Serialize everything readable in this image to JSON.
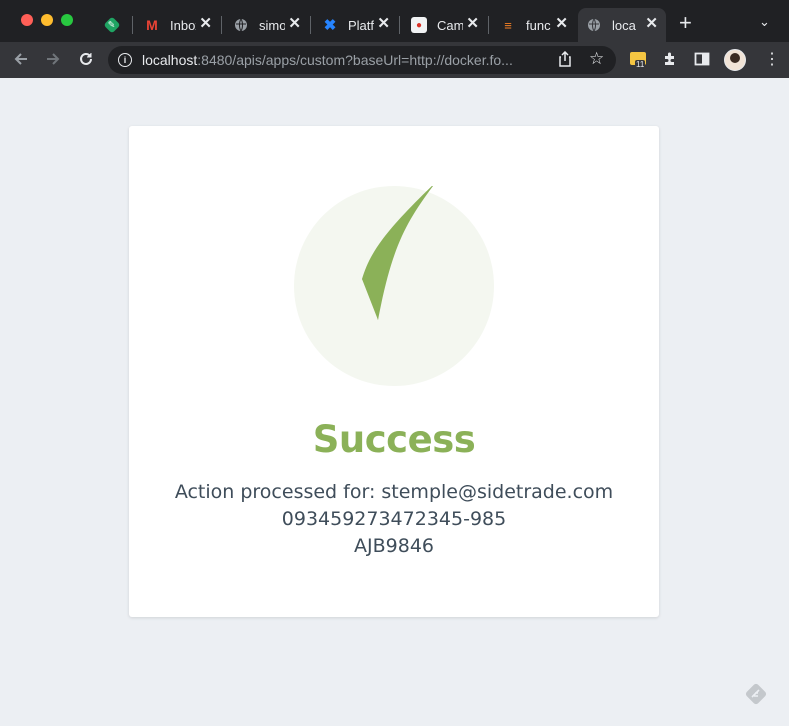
{
  "browser": {
    "tabs": [
      {
        "title": "",
        "favicon": "feather-green-icon"
      },
      {
        "title": "Inbox",
        "favicon": "gmail-icon"
      },
      {
        "title": "simo",
        "favicon": "globe-icon"
      },
      {
        "title": "Platf",
        "favicon": "confluence-icon"
      },
      {
        "title": "Cam",
        "favicon": "app-icon"
      },
      {
        "title": "func",
        "favicon": "stackoverflow-icon"
      },
      {
        "title": "loca",
        "favicon": "globe-icon"
      }
    ],
    "url_host": "localhost",
    "url_rest": ":8480/apis/apps/custom?baseUrl=http://docker.fo...",
    "extension_badge": "11"
  },
  "page": {
    "title": "Success",
    "message_line1": "Action processed for: stemple@sidetrade.com",
    "message_line2": "093459273472345-985",
    "message_line3": "AJB9846"
  },
  "colors": {
    "success_green": "#8bb158",
    "circle_bg": "#f4f7f0",
    "page_bg": "#eceff3",
    "text": "#3f4d5a"
  }
}
